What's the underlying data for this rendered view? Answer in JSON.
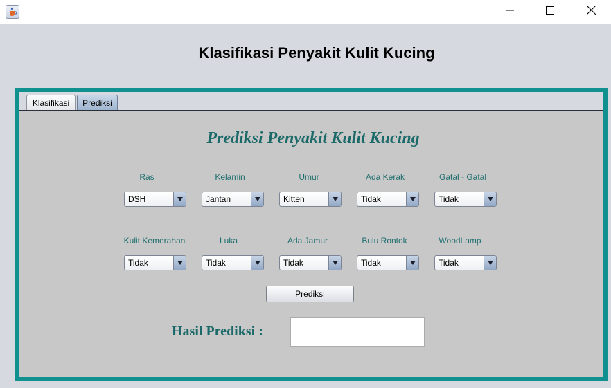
{
  "window": {
    "app_icon": "java-cup-icon",
    "controls": [
      "minimize-icon",
      "maximize-icon",
      "close-icon"
    ]
  },
  "header": {
    "title": "Klasifikasi Penyakit Kulit Kucing"
  },
  "tabs": [
    {
      "label": "Klasifikasi",
      "selected": false
    },
    {
      "label": "Prediksi",
      "selected": true
    }
  ],
  "form": {
    "title": "Prediksi Penyakit Kulit Kucing",
    "row1": [
      {
        "label": "Ras",
        "value": "DSH"
      },
      {
        "label": "Kelamin",
        "value": "Jantan"
      },
      {
        "label": "Umur",
        "value": "Kitten"
      },
      {
        "label": "Ada Kerak",
        "value": "Tidak"
      },
      {
        "label": "Gatal - Gatal",
        "value": "Tidak"
      }
    ],
    "row2": [
      {
        "label": "Kulit Kemerahan",
        "value": "Tidak"
      },
      {
        "label": "Luka",
        "value": "Tidak"
      },
      {
        "label": "Ada Jamur",
        "value": "Tidak"
      },
      {
        "label": "Bulu Rontok",
        "value": "Tidak"
      },
      {
        "label": "WoodLamp",
        "value": "Tidak"
      }
    ],
    "predict_button": "Prediksi",
    "result_label": "Hasil Prediksi :",
    "result_value": ""
  },
  "colors": {
    "frame": "#10908e",
    "accent_text": "#1b6a69",
    "panel": "#c8c8c8",
    "background": "#d6d9df"
  }
}
